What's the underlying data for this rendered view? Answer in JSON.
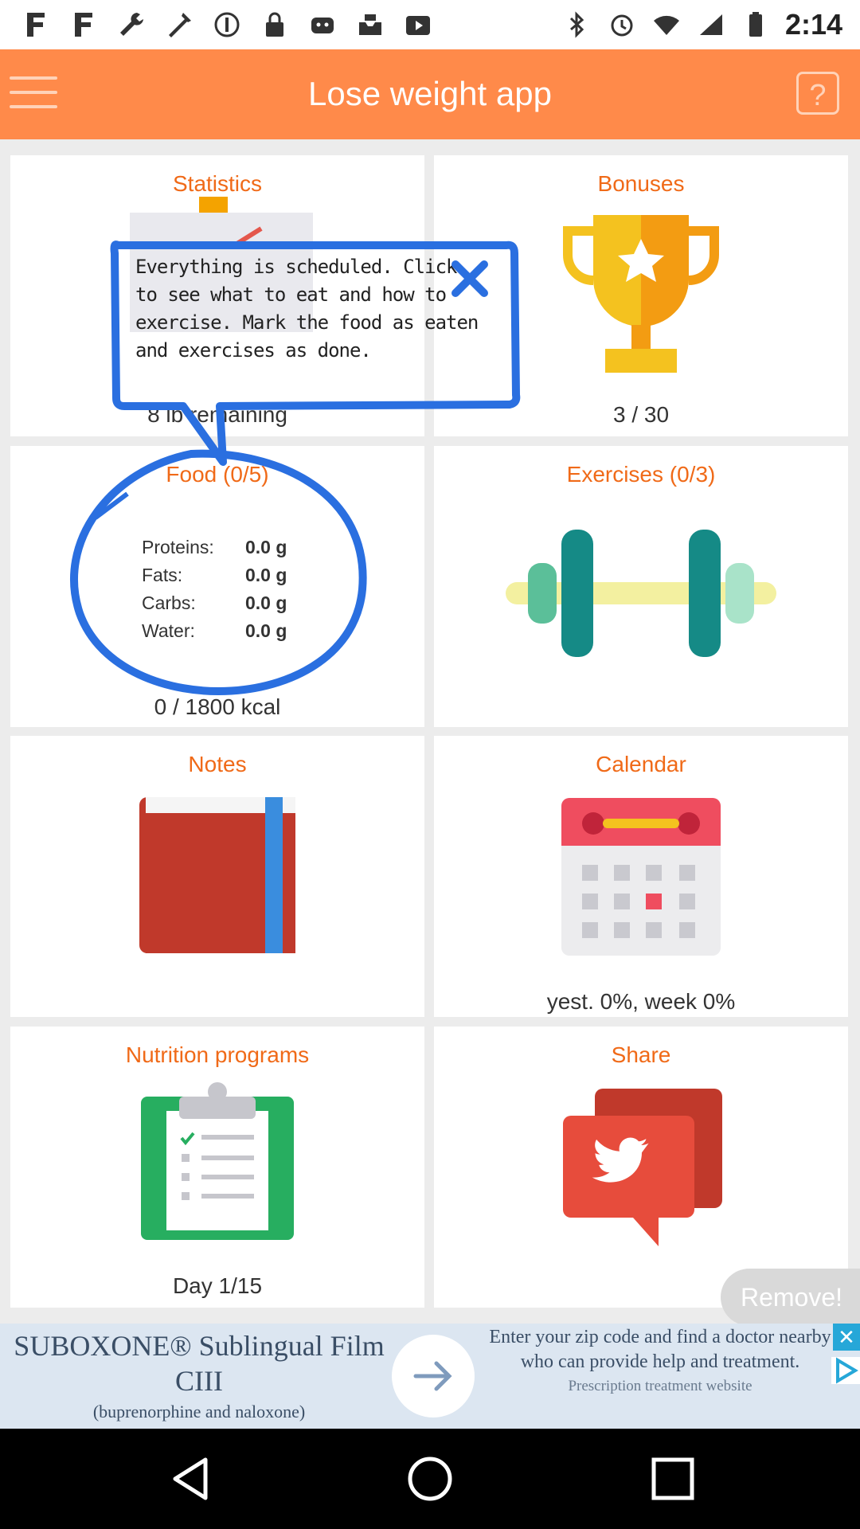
{
  "status_bar": {
    "time": "2:14"
  },
  "app_bar": {
    "title": "Lose weight app",
    "help_label": "?"
  },
  "tiles": {
    "statistics": {
      "title": "Statistics",
      "footer": "8 lb remaining"
    },
    "bonuses": {
      "title": "Bonuses",
      "footer": "3 / 30"
    },
    "food": {
      "title": "Food (0/5)",
      "rows": [
        {
          "label": "Proteins:",
          "value": "0.0 g"
        },
        {
          "label": "Fats:",
          "value": "0.0 g"
        },
        {
          "label": "Carbs:",
          "value": "0.0 g"
        },
        {
          "label": "Water:",
          "value": "0.0 g"
        }
      ],
      "footer": "0 / 1800 kcal"
    },
    "exercises": {
      "title": "Exercises (0/3)"
    },
    "notes": {
      "title": "Notes"
    },
    "calendar": {
      "title": "Calendar",
      "footer": "yest. 0%, week 0%"
    },
    "nutrition": {
      "title": "Nutrition programs",
      "footer": "Day 1/15"
    },
    "share": {
      "title": "Share"
    }
  },
  "tooltip": {
    "text": "Everything is scheduled. Click to see what to eat and how to exercise. Mark the food as eaten and exercises as done."
  },
  "remove_label": "Remove!",
  "ad": {
    "headline": "SUBOXONE® Sublingual Film CIII",
    "subline": "(buprenorphine and naloxone)",
    "right_text": "Enter your zip code and find a doctor nearby who can provide help and treatment.",
    "right_sub": "Prescription treatment website"
  },
  "colors": {
    "accent": "#ff8a4a",
    "title_orange": "#f06a18",
    "tooltip_blue": "#2a6fe0"
  }
}
